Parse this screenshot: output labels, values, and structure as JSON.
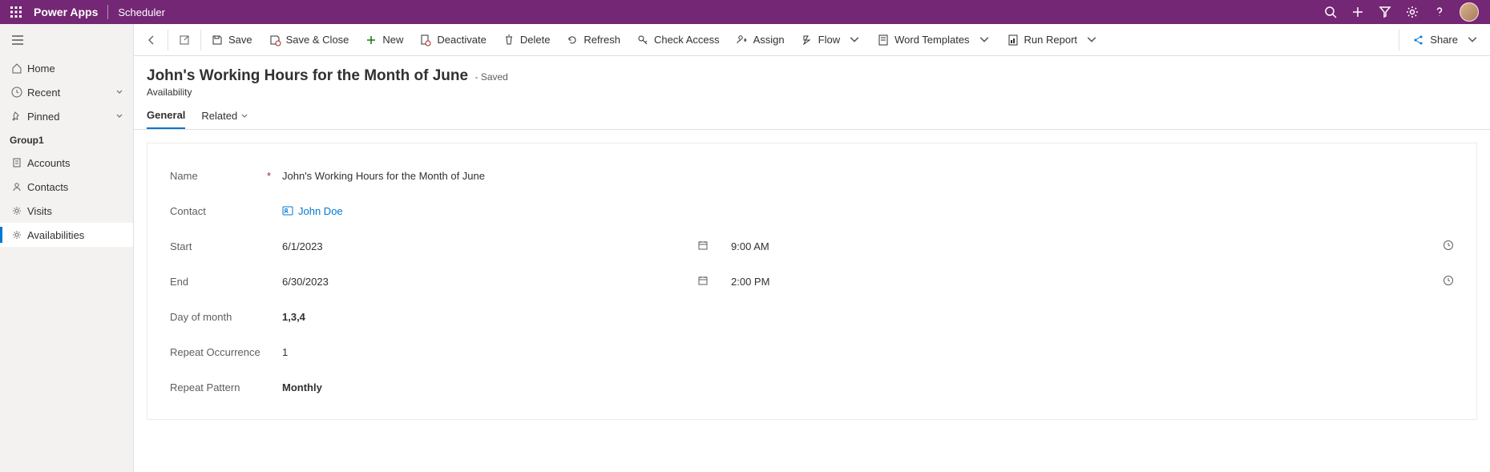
{
  "header": {
    "brand": "Power Apps",
    "app": "Scheduler"
  },
  "sidenav": {
    "home": "Home",
    "recent": "Recent",
    "pinned": "Pinned",
    "group_label": "Group1",
    "accounts": "Accounts",
    "contacts": "Contacts",
    "visits": "Visits",
    "availabilities": "Availabilities"
  },
  "commands": {
    "save": "Save",
    "save_close": "Save & Close",
    "new": "New",
    "deactivate": "Deactivate",
    "delete": "Delete",
    "refresh": "Refresh",
    "check_access": "Check Access",
    "assign": "Assign",
    "flow": "Flow",
    "word_templates": "Word Templates",
    "run_report": "Run Report",
    "share": "Share"
  },
  "record": {
    "title": "John's Working Hours for the Month of June",
    "status": "- Saved",
    "entity": "Availability"
  },
  "tabs": {
    "general": "General",
    "related": "Related"
  },
  "form": {
    "name_label": "Name",
    "name_value": "John's Working Hours for the Month of June",
    "contact_label": "Contact",
    "contact_value": "John Doe",
    "start_label": "Start",
    "start_date": "6/1/2023",
    "start_time": "9:00 AM",
    "end_label": "End",
    "end_date": "6/30/2023",
    "end_time": "2:00 PM",
    "day_of_month_label": "Day of month",
    "day_of_month_value": "1,3,4",
    "repeat_occurrence_label": "Repeat Occurrence",
    "repeat_occurrence_value": "1",
    "repeat_pattern_label": "Repeat Pattern",
    "repeat_pattern_value": "Monthly"
  }
}
